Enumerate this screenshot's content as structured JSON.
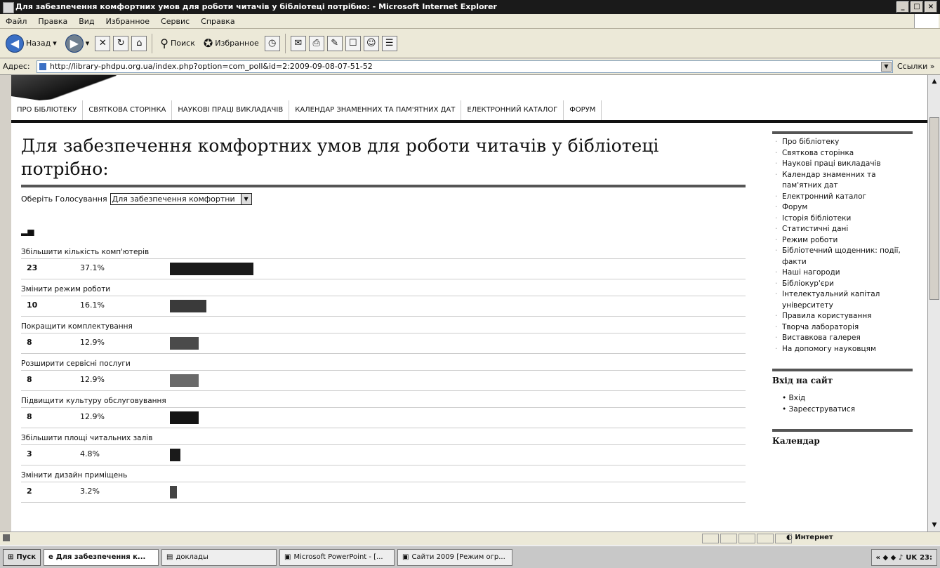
{
  "window": {
    "title": "Для забезпечення комфортних умов для роботи читачів у бібліотеці потрібно: - Microsoft Internet Explorer",
    "min": "_",
    "max": "□",
    "close": "×"
  },
  "menu": [
    "Файл",
    "Правка",
    "Вид",
    "Избранное",
    "Сервис",
    "Справка"
  ],
  "toolbar": {
    "back": "Назад",
    "search": "Поиск",
    "favorites": "Избранное"
  },
  "address": {
    "label": "Адрес:",
    "url": "http://library-phdpu.org.ua/index.php?option=com_poll&id=2:2009-09-08-07-51-52",
    "links": "Ссылки »"
  },
  "nav": [
    "ПРО БІБЛІОТЕКУ",
    "СВЯТКОВА СТОРІНКА",
    "НАУКОВІ ПРАЦІ ВИКЛАДАЧІВ",
    "КАЛЕНДАР ЗНАМЕННИХ ТА ПАМ'ЯТНИХ ДАТ",
    "ЕЛЕКТРОННИЙ КАТАЛОГ",
    "ФОРУМ"
  ],
  "page": {
    "title": "Для забезпечення комфортних умов для роботи читачів у бібліотеці потрібно:",
    "select_label": "Оберіть Голосування",
    "select_value": "Для забезпечення комфортни",
    "chart_icon": "chart-icon"
  },
  "poll": [
    {
      "question": "Збільшити кількість комп'ютерів",
      "votes": "23",
      "percent": "37.1%",
      "fraction": 0.371,
      "color": "#1a1a1a"
    },
    {
      "question": "Змінити режим роботи",
      "votes": "10",
      "percent": "16.1%",
      "fraction": 0.161,
      "color": "#3a3a3a"
    },
    {
      "question": "Покращити комплектування",
      "votes": "8",
      "percent": "12.9%",
      "fraction": 0.129,
      "color": "#4a4a4a"
    },
    {
      "question": "Розширити сервісні послуги",
      "votes": "8",
      "percent": "12.9%",
      "fraction": 0.129,
      "color": "#6a6a6a"
    },
    {
      "question": "Підвищити культуру обслуговування",
      "votes": "8",
      "percent": "12.9%",
      "fraction": 0.129,
      "color": "#151515"
    },
    {
      "question": "Збільшити площі читальних залів",
      "votes": "3",
      "percent": "4.8%",
      "fraction": 0.048,
      "color": "#1a1a1a"
    },
    {
      "question": "Змінити дизайн приміщень",
      "votes": "2",
      "percent": "3.2%",
      "fraction": 0.032,
      "color": "#444444"
    }
  ],
  "sidebar": {
    "items": [
      "Про бібліотеку",
      "Святкова сторінка",
      "Наукові праці викладачів",
      "Календар знаменних та пам'ятних дат",
      "Електронний каталог",
      "Форум",
      "Історія бібліотеки",
      "Статистичні дані",
      "Режим роботи",
      "Бібліотечний щоденник: події, факти",
      "Наші нагороди",
      "Бібліокур'єри",
      "Інтелектуальний капітал університету",
      "Правила користування",
      "Творча лабораторія",
      "Виставкова галерея",
      "На допомогу науковцям"
    ],
    "login_heading": "Вхід на сайт",
    "login_items": [
      "Вхід",
      "Зареєструватися"
    ],
    "calendar_heading": "Календар"
  },
  "status": {
    "zone": "Интернет"
  },
  "taskbar": {
    "start": "Пуск",
    "buttons": [
      "Для забезпечення к...",
      "доклады",
      "Microsoft PowerPoint - [...",
      "Сайти 2009 [Режим огр..."
    ],
    "lang": "UK",
    "clock": "23:"
  }
}
